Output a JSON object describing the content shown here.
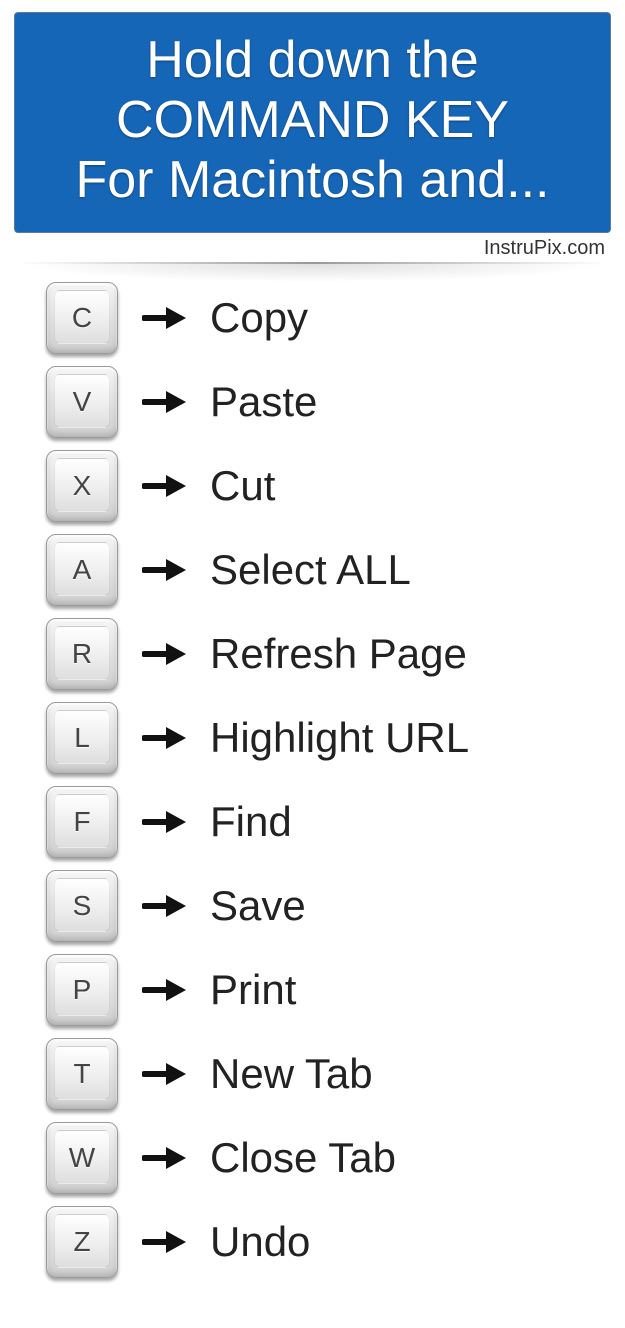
{
  "header": {
    "line1": "Hold down the",
    "line2": "COMMAND KEY",
    "line3": "For Macintosh and..."
  },
  "attribution": "InstruPix.com",
  "shortcuts": [
    {
      "key": "C",
      "action": "Copy"
    },
    {
      "key": "V",
      "action": "Paste"
    },
    {
      "key": "X",
      "action": "Cut"
    },
    {
      "key": "A",
      "action": "Select  ALL"
    },
    {
      "key": "R",
      "action": "Refresh Page"
    },
    {
      "key": "L",
      "action": "Highlight URL"
    },
    {
      "key": "F",
      "action": "Find"
    },
    {
      "key": "S",
      "action": "Save"
    },
    {
      "key": "P",
      "action": "Print"
    },
    {
      "key": "T",
      "action": "New Tab"
    },
    {
      "key": "W",
      "action": "Close Tab"
    },
    {
      "key": "Z",
      "action": "Undo"
    }
  ]
}
